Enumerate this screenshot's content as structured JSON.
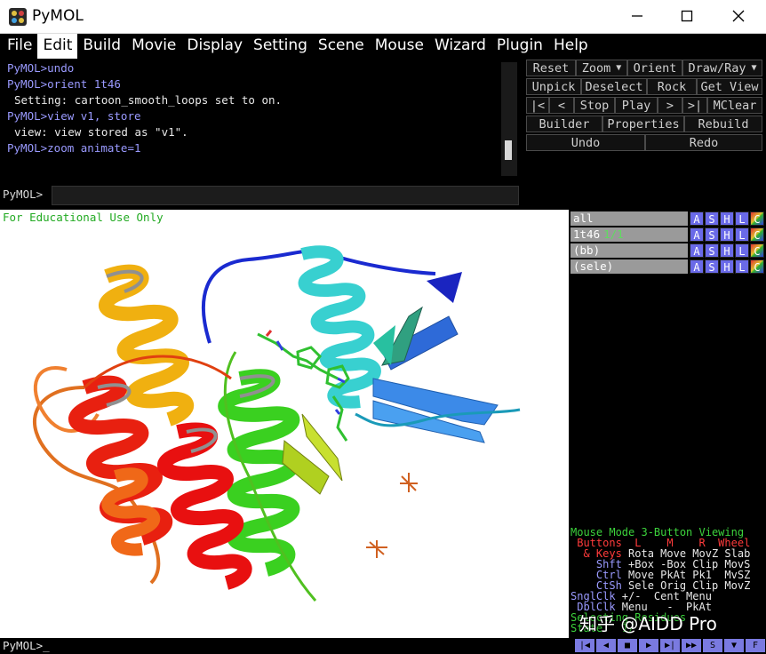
{
  "window": {
    "title": "PyMOL"
  },
  "menu": {
    "items": [
      "File",
      "Edit",
      "Build",
      "Movie",
      "Display",
      "Setting",
      "Scene",
      "Mouse",
      "Wizard",
      "Plugin",
      "Help"
    ],
    "active": "Edit"
  },
  "console": {
    "lines": [
      {
        "type": "prompt",
        "text": "PyMOL>undo"
      },
      {
        "type": "prompt",
        "text": "PyMOL>orient 1t46"
      },
      {
        "type": "out",
        "text": "Setting: cartoon_smooth_loops set to on."
      },
      {
        "type": "prompt",
        "text": "PyMOL>view v1, store"
      },
      {
        "type": "out",
        "text": "view: view stored as \"v1\"."
      },
      {
        "type": "prompt",
        "text": "PyMOL>zoom animate=1"
      }
    ]
  },
  "command": {
    "label": "PyMOL>",
    "value": ""
  },
  "buttons": {
    "reset": "Reset",
    "zoom": "Zoom",
    "orient": "Orient",
    "drawray": "Draw/Ray",
    "unpick": "Unpick",
    "deselect": "Deselect",
    "rock": "Rock",
    "getview": "Get View",
    "first": "|<",
    "prev": "<",
    "stop": "Stop",
    "play": "Play",
    "next": ">",
    "last": ">|",
    "mclear": "MClear",
    "builder": "Builder",
    "properties": "Properties",
    "rebuild": "Rebuild",
    "undo": "Undo",
    "redo": "Redo"
  },
  "viewport": {
    "notice": "For Educational Use Only"
  },
  "objects": [
    {
      "name": "all",
      "state": ""
    },
    {
      "name": "1t46",
      "state": "1/1"
    },
    {
      "name": "(bb)",
      "state": ""
    },
    {
      "name": "(sele)",
      "state": ""
    }
  ],
  "object_buttons": [
    "A",
    "S",
    "H",
    "L",
    "C"
  ],
  "mouse_mode": {
    "title": "Mouse Mode 3-Button Viewing",
    "header": " Buttons  L    M    R  Wheel",
    "rows": [
      {
        "key": "  & Keys",
        "vals": " Rota Move MovZ Slab",
        "cls": "mm-key"
      },
      {
        "key": "    Shft",
        "vals": " +Box -Box Clip MovS",
        "cls": "mm-key2"
      },
      {
        "key": "    Ctrl",
        "vals": " Move PkAt Pk1  MvSZ",
        "cls": "mm-key2"
      },
      {
        "key": "    CtSh",
        "vals": " Sele Orig Clip MovZ",
        "cls": "mm-key2"
      },
      {
        "key": "SnglClk",
        "vals": " +/-  Cent Menu",
        "cls": "mm-key2"
      },
      {
        "key": " DblClk",
        "vals": " Menu   -  PkAt",
        "cls": "mm-key2"
      }
    ],
    "footer1": "Selecting Residues",
    "footer2": "State   1/"
  },
  "watermark": "知乎 @AIDD Pro",
  "bottom": {
    "prompt": "PyMOL>_"
  },
  "movie_buttons": [
    "|◀",
    "◀",
    "■",
    "▶",
    "▶|",
    "▶▶",
    "S",
    "▼",
    "F"
  ],
  "colors": {
    "prompt": "#9a9aff",
    "accent_green": "#22aa22",
    "obj_a": "#6a6ae8",
    "obj_c": "#e03030"
  }
}
